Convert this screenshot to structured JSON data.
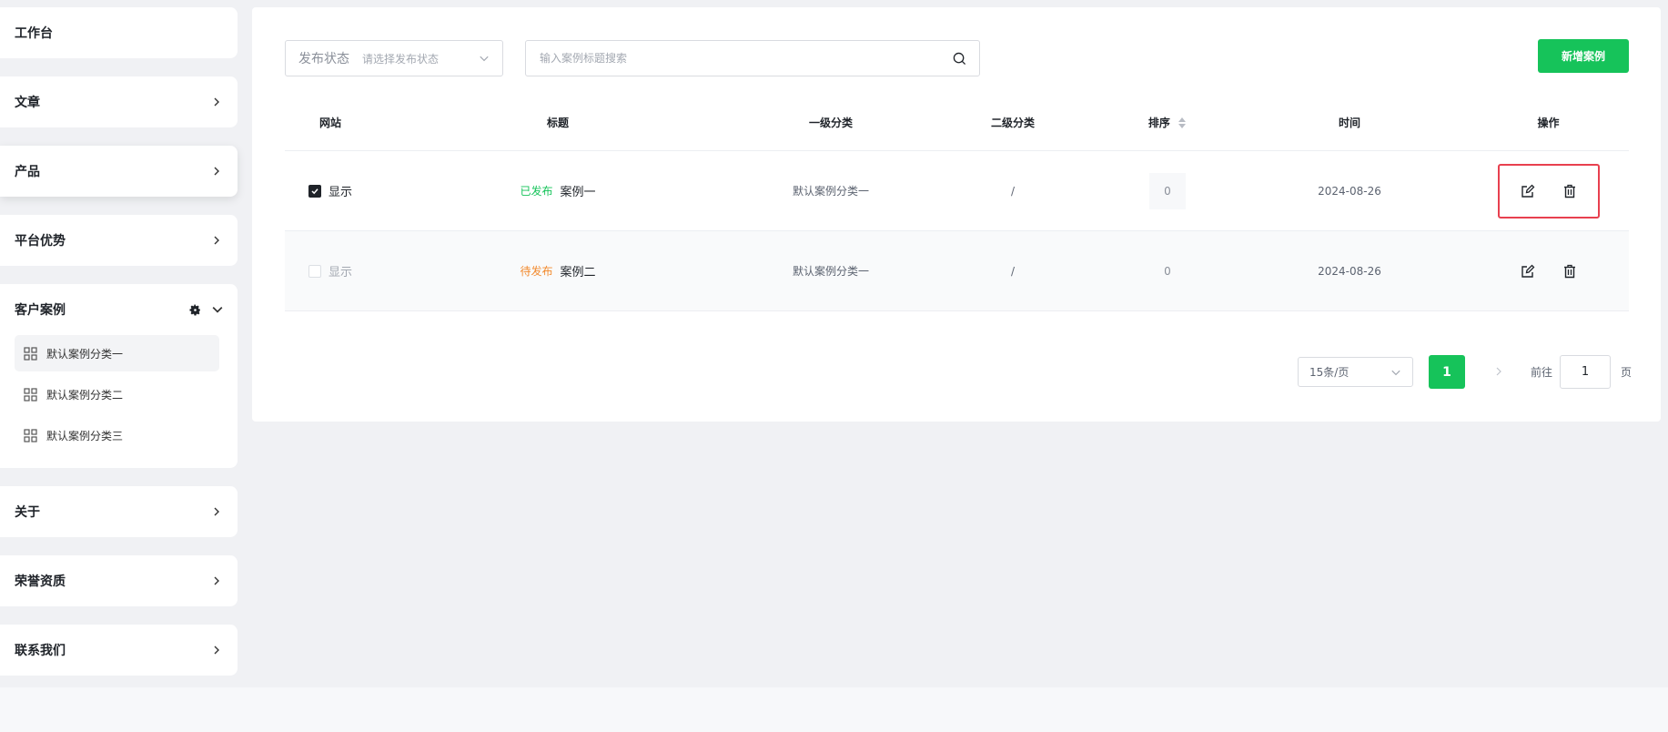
{
  "sidebar": {
    "workbench": "工作台",
    "articles": "文章",
    "products": "产品",
    "advantages": "平台优势",
    "cases": {
      "label": "客户案例",
      "items": [
        {
          "label": "默认案例分类一"
        },
        {
          "label": "默认案例分类二"
        },
        {
          "label": "默认案例分类三"
        }
      ]
    },
    "about": "关于",
    "honors": "荣誉资质",
    "contact": "联系我们"
  },
  "filters": {
    "status_label": "发布状态",
    "status_placeholder": "请选择发布状态",
    "search_placeholder": "输入案例标题搜索",
    "add_button": "新增案例"
  },
  "table": {
    "columns": [
      "网站",
      "标题",
      "一级分类",
      "二级分类",
      "排序",
      "时间",
      "操作"
    ],
    "rows": [
      {
        "website": "显示",
        "checked": true,
        "status": "已发布",
        "title": "案例一",
        "category1": "默认案例分类一",
        "category2": "/",
        "sort": "0",
        "time": "2024-08-26"
      },
      {
        "website": "显示",
        "checked": false,
        "status": "待发布",
        "title": "案例二",
        "category1": "默认案例分类一",
        "category2": "/",
        "sort": "0",
        "time": "2024-08-26"
      }
    ]
  },
  "pagination": {
    "page_size": "15条/页",
    "current_page": "1",
    "goto_label": "前往",
    "goto_value": "1",
    "page_suffix": "页"
  },
  "colors": {
    "accent": "#16c35a",
    "published": "#16c35a",
    "pending": "#f28a2e",
    "highlight": "#e8404f"
  }
}
